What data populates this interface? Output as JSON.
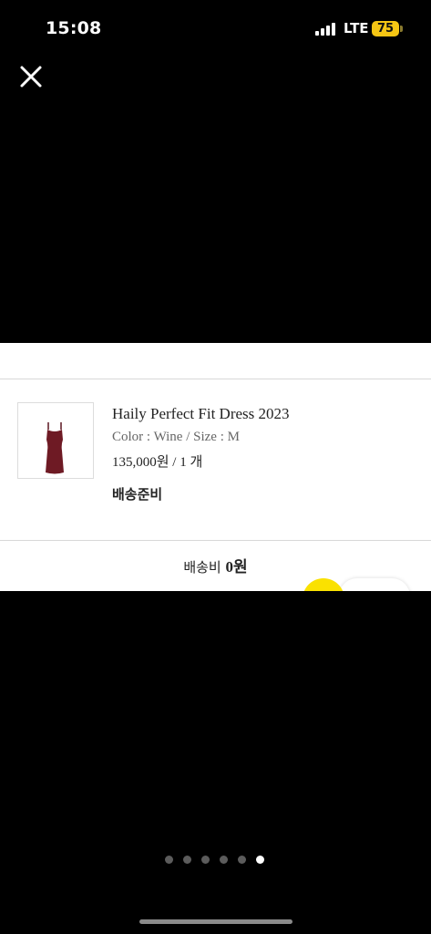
{
  "status_bar": {
    "time": "15:08",
    "network": "LTE",
    "battery": "75",
    "battery_color": "#f6c614"
  },
  "viewer": {
    "close_icon": "close-icon",
    "pages_total": 6,
    "active_page": 6
  },
  "order": {
    "product_name": "Haily Perfect Fit Dress 2023",
    "options": "Color : Wine / Size : M",
    "price_qty": "135,000원 / 1 개",
    "status": "배송준비",
    "shipping_label": "배송비",
    "shipping_value": "0원",
    "dress_color": "#6e1a24"
  }
}
